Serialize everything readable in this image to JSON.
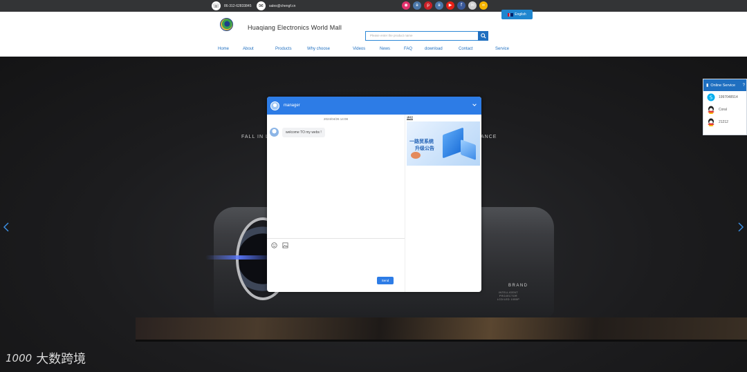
{
  "topbar": {
    "phone": "86-312-62833845",
    "email": "sales@chengf.cn",
    "social": [
      {
        "name": "instagram-icon",
        "color": "#e1306c",
        "glyph": "◉"
      },
      {
        "name": "vk-icon",
        "color": "#4a76a8",
        "glyph": "в"
      },
      {
        "name": "pinterest-icon",
        "color": "#cb2027",
        "glyph": "p"
      },
      {
        "name": "vk2-icon",
        "color": "#4a76a8",
        "glyph": "в"
      },
      {
        "name": "youtube-icon",
        "color": "#e62117",
        "glyph": "▶"
      },
      {
        "name": "facebook-icon",
        "color": "#3b5998",
        "glyph": "f"
      },
      {
        "name": "email-share-icon",
        "color": "#cfcfcf",
        "glyph": "✉"
      },
      {
        "name": "share-icon",
        "color": "#f5b400",
        "glyph": "∞"
      }
    ]
  },
  "language": {
    "label": "English"
  },
  "header": {
    "title": "Huaqiang Electronics World Mall",
    "search_placeholder": "Please enter the product name"
  },
  "nav": [
    {
      "label": "Home",
      "key": "home"
    },
    {
      "label": "About",
      "key": "about"
    },
    {
      "label": "Products",
      "key": "products"
    },
    {
      "label": "Why choose",
      "key": "why-choose"
    },
    {
      "label": "Videos",
      "key": "videos"
    },
    {
      "label": "News",
      "key": "news"
    },
    {
      "label": "FAQ",
      "key": "faq"
    },
    {
      "label": "download",
      "key": "download"
    },
    {
      "label": "Contact",
      "key": "contact"
    },
    {
      "label": "Service",
      "key": "service"
    }
  ],
  "hero": {
    "text_left": "FALL IN L",
    "text_right": "ANCE",
    "brand": "BRAND",
    "brand_sub": "INTELLIGENT PROJECTOR",
    "brand_sub2": "LCD/LED 1080P"
  },
  "online_service": {
    "title": "Online Service",
    "contacts": [
      "1997048514",
      "Coral",
      "21212"
    ]
  },
  "chat": {
    "agent": "manager",
    "timestamp": "2024/04/26 14:08",
    "message": "welcome TO my webs !",
    "send_label": "Send",
    "notice_label": "通知",
    "notice_line1": "一路贸系统",
    "notice_line2": "升级公告"
  },
  "watermark": {
    "text": "大数跨境",
    "logo": "1000"
  },
  "colors": {
    "accent": "#1f6fc0",
    "chat_header": "#2d7ce6",
    "topbar": "#333436"
  }
}
